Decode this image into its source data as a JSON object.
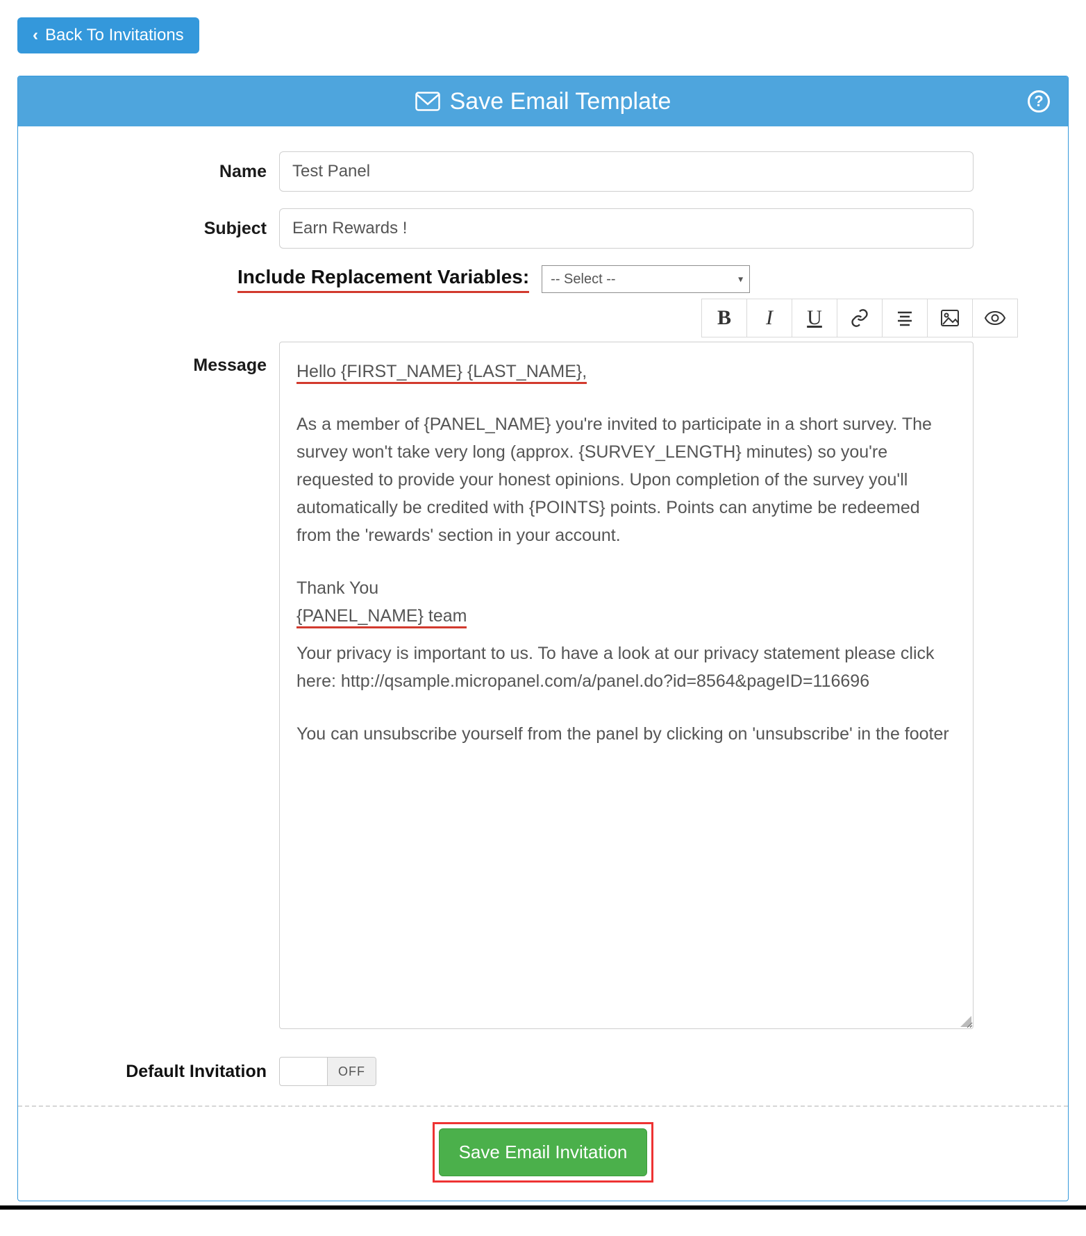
{
  "back_button": "Back To Invitations",
  "panel_title": "Save Email Template",
  "labels": {
    "name": "Name",
    "subject": "Subject",
    "vars": "Include Replacement Variables:",
    "message": "Message",
    "default_invitation": "Default Invitation"
  },
  "fields": {
    "name_value": "Test Panel",
    "subject_value": "Earn Rewards !",
    "vars_select": "-- Select --",
    "default_toggle": "OFF"
  },
  "message": {
    "greeting": "Hello {FIRST_NAME} {LAST_NAME},",
    "body1": "As a member of {PANEL_NAME} you're invited to participate in a short survey. The survey won't take very long (approx. {SURVEY_LENGTH} minutes) so you're requested to provide your honest opinions. Upon completion of the survey you'll automatically be credited with {POINTS} points. Points can anytime be redeemed from the 'rewards' section in your account.",
    "thank": "Thank You",
    "team": "{PANEL_NAME} team",
    "privacy": "Your privacy is important to us. To have a look at our privacy statement please click here: http://qsample.micropanel.com/a/panel.do?id=8564&pageID=116696",
    "unsub": "You can unsubscribe yourself from the panel by clicking on 'unsubscribe' in the footer"
  },
  "save_button": "Save Email Invitation",
  "toolbar": {
    "bold": "B",
    "italic": "I",
    "underline": "U"
  }
}
